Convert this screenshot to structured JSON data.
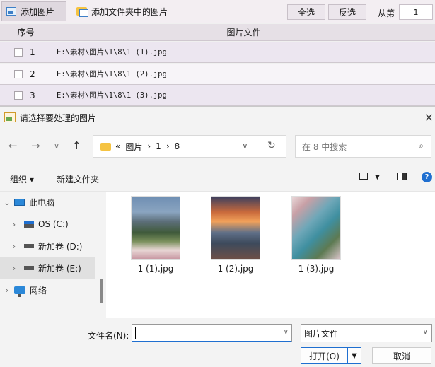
{
  "toolbar": {
    "add_image": "添加图片",
    "add_folder": "添加文件夹中的图片",
    "select_all": "全选",
    "invert": "反选",
    "from_label": "从第",
    "from_value": "1"
  },
  "table": {
    "col_index": "序号",
    "col_file": "图片文件",
    "rows": [
      {
        "index": "1",
        "path": "E:\\素材\\图片\\1\\8\\1 (1).jpg"
      },
      {
        "index": "2",
        "path": "E:\\素材\\图片\\1\\8\\1 (2).jpg"
      },
      {
        "index": "3",
        "path": "E:\\素材\\图片\\1\\8\\1 (3).jpg"
      }
    ]
  },
  "dialog": {
    "title": "请选择要处理的图片",
    "close": "×",
    "breadcrumb": {
      "prefix": "«",
      "parts": [
        "图片",
        "1",
        "8"
      ]
    },
    "search_placeholder": "在 8 中搜索",
    "organize": "组织 ▾",
    "new_folder": "新建文件夹",
    "nav": [
      {
        "label": "此电脑"
      },
      {
        "label": "OS (C:)"
      },
      {
        "label": "新加卷 (D:)"
      },
      {
        "label": "新加卷 (E:)"
      },
      {
        "label": "网络"
      }
    ],
    "files": [
      {
        "name": "1 (1).jpg"
      },
      {
        "name": "1 (2).jpg"
      },
      {
        "name": "1 (3).jpg"
      }
    ],
    "filename_label": "文件名(N):",
    "filename_value": "",
    "filetype": "图片文件",
    "open": "打开(O)",
    "cancel": "取消"
  }
}
